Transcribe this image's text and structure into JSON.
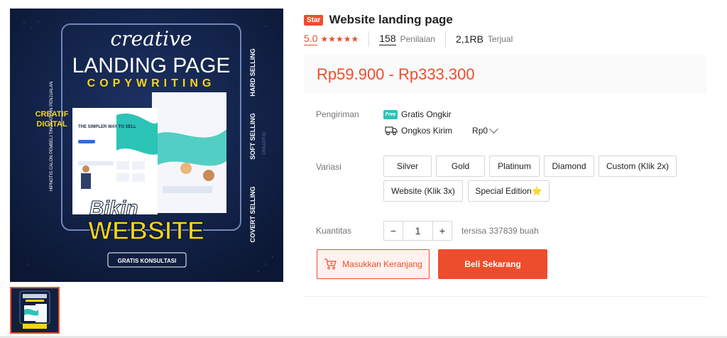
{
  "product": {
    "badge": "Star",
    "title": "Website landing page",
    "rating": "5.0",
    "stars": "★★★★★",
    "review_count": "158",
    "review_label": "Penilaian",
    "sold_count": "2,1RB",
    "sold_label": "Terjual",
    "price": "Rp59.900 - Rp333.300"
  },
  "image_art": {
    "script_title": "creative",
    "landing": "LANDING PAGE",
    "copy": "COPYWRITING",
    "side_creatif": "CREATIF",
    "side_digital": "DIGITAL",
    "left_vertical_1": "TINGKATKAN PENJUALAN",
    "left_vertical_2": "HIPNOTIS CALON PEMBELI",
    "right_hard": "HARD SELLING",
    "right_soft": "SOFT SELLING",
    "right_covert": "COVERT SELLING",
    "right_site": "CREATIF.ID",
    "bikin": "Bikin",
    "website": "WEBSITE",
    "konsultasi": "GRATIS KONSULTASI",
    "mock_headline": "THE SIMPLER WAY TO SELL"
  },
  "shipping": {
    "label": "Pengiriman",
    "free_badge": "Free",
    "free_text": "Gratis Ongkir",
    "cost_label": "Ongkos Kirim",
    "cost_value": "Rp0"
  },
  "variants": {
    "label": "Variasi",
    "options": [
      "Silver",
      "Gold",
      "Platinum",
      "Diamond",
      "Custom (Klik 2x)",
      "Website (Klik 3x)",
      "Special Edition⭐"
    ]
  },
  "quantity": {
    "label": "Kuantitas",
    "minus": "−",
    "value": "1",
    "plus": "+",
    "stock": "tersisa 337839 buah"
  },
  "actions": {
    "add_to_cart": "Masukkan Keranjang",
    "buy_now": "Beli Sekarang"
  },
  "colors": {
    "accent": "#ee4d2d",
    "image_bg": "#10203f",
    "highlight_yellow": "#f7d417",
    "teal": "#2bc4b6"
  }
}
